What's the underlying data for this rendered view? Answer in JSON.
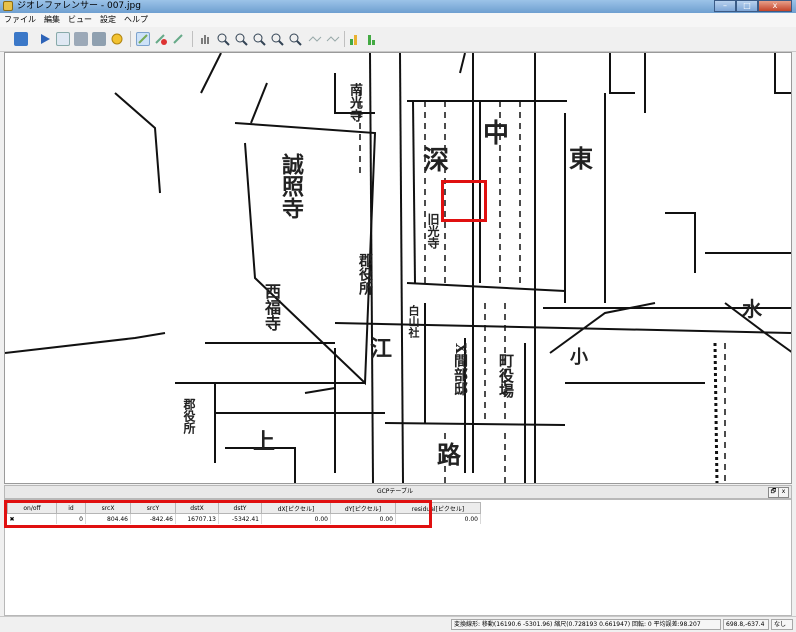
{
  "window": {
    "title": "ジオレファレンサー - 007.jpg",
    "controls": {
      "minimize": "–",
      "maximize": "□",
      "close": "x"
    }
  },
  "menu": {
    "items": [
      "ファイル",
      "編集",
      "ビュー",
      "設定",
      "ヘルプ"
    ]
  },
  "toolbar": {
    "tools": [
      "open-raster-icon",
      "start-georef-icon",
      "gcp-table-icon",
      "load-gcp-icon",
      "save-gcp-icon",
      "settings-icon",
      "add-point-icon",
      "delete-point-icon",
      "move-point-icon",
      "pan-icon",
      "zoom-in-icon",
      "zoom-out-icon",
      "zoom-layer-icon",
      "zoom-last-icon",
      "zoom-next-icon",
      "link-georef-icon",
      "link-qgis-icon",
      "full-histogram-icon",
      "local-histogram-icon"
    ],
    "selected": [
      "add-point-icon"
    ]
  },
  "map": {
    "labels": {
      "seishoji": "誠照寺",
      "fuka": "深",
      "naka": "中",
      "higashi": "東",
      "nanko": "南光寺",
      "gunyakusho": "郡役所",
      "nishifukuji": "西福寺",
      "e": "江",
      "ue": "上",
      "ji": "路",
      "kotiyakuba": "町役場",
      "mizu": "水",
      "ko": "小",
      "gunyakusho2": "郡役所",
      "hakusan": "白山社",
      "koma": "X間部邸",
      "kanko": "旧光寺"
    }
  },
  "gcp": {
    "title": "GCPテーブル",
    "float_label": "🗗",
    "close_label": "x",
    "columns": [
      "on/off",
      "id",
      "srcX",
      "srcY",
      "dstX",
      "dstY",
      "dX[ピクセル]",
      "dY[ピクセル]",
      "residual[ピクセル]"
    ],
    "rows": [
      {
        "on": "✖",
        "id": "0",
        "srcX": "804.46",
        "srcY": "-842.46",
        "dstX": "16707.13",
        "dstY": "-5342.41",
        "dX": "0.00",
        "dY": "0.00",
        "residual": "0.00"
      }
    ]
  },
  "status": {
    "transform": "変換線形: 移動(16190.6 -5301.96) 縮尺(0.728193 0.661947) 回転: 0 平均誤差:98.207",
    "coords": "698.8,-637.4",
    "crs": "なし"
  },
  "colors": {
    "highlight": "#e01010"
  }
}
